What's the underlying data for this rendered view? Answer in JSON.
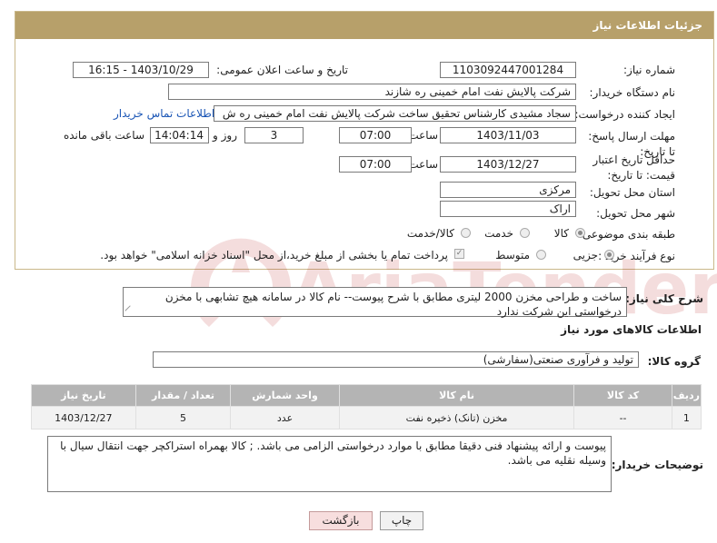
{
  "header": {
    "title": "جزئیات اطلاعات نیاز"
  },
  "labels": {
    "need_number": "شماره نیاز:",
    "announce_datetime": "تاریخ و ساعت اعلان عمومی:",
    "buyer_org": "نام دستگاه خریدار:",
    "requester": "ایجاد کننده درخواست:",
    "reply_deadline": "مهلت ارسال پاسخ: تا تاریخ:",
    "price_validity": "حداقل تاریخ اعتبار قیمت: تا تاریخ:",
    "hour": "ساعت",
    "day_and": "روز و",
    "remaining": "ساعت باقی مانده",
    "province": "استان محل تحویل:",
    "city": "شهر محل تحویل:",
    "category": "طبقه بندی موضوعی:",
    "purchase_type": "نوع فرآیند خرید :",
    "description": "شرح کلی نیاز:",
    "goods_info": "اطلاعات کالاهای مورد نیاز",
    "goods_group": "گروه کالا:",
    "buyer_notes": "توضیحات خریدار:"
  },
  "values": {
    "need_number": "1103092447001284",
    "announce_datetime": "1403/10/29 - 16:15",
    "buyer_org": "شرکت پالایش نفت امام خمینی  ره  شازند",
    "requester": "سجاد مشیدی  کارشناس تحقیق ساخت شرکت پالایش نفت امام خمینی  ره  ش",
    "contact_link": "اطلاعات تماس خریدار",
    "reply_date": "1403/11/03",
    "reply_time": "07:00",
    "reply_days": "3",
    "reply_remaining": "14:04:14",
    "validity_date": "1403/12/27",
    "validity_time": "07:00",
    "province": "مرکزی",
    "city": "اراک",
    "description": "ساخت و طراحی مخزن 2000 لیتری مطابق با شرح پیوست-- نام کالا در سامانه هیچ تشابهی با مخزن درخواستی این شرکت ندارد",
    "goods_group": "تولید و فرآوری صنعتی(سفارشی)",
    "buyer_notes": "پیوست و ارائه پیشنهاد فنی دقیقا مطابق با موارد درخواستی الزامی می باشد. ; کالا بهمراه استراکچر جهت انتقال سیال با وسیله نقلیه می باشد."
  },
  "category_options": {
    "goods": "کالا",
    "service": "خدمت",
    "goods_service": "کالا/خدمت",
    "selected": "کالا"
  },
  "purchase_options": {
    "partial": "جزیی",
    "medium": "متوسط",
    "treasury_note": "پرداخت تمام یا بخشی از مبلغ خرید،از محل \"اسناد خزانه اسلامی\" خواهد بود.",
    "selected": "جزیی"
  },
  "table": {
    "headers": [
      "ردیف",
      "کد کالا",
      "نام کالا",
      "واحد شمارش",
      "تعداد / مقدار",
      "تاریخ نیاز"
    ],
    "rows": [
      {
        "row": "1",
        "code": "--",
        "name": "مخزن (تانک) ذخیره نفت",
        "unit": "عدد",
        "qty": "5",
        "date": "1403/12/27"
      }
    ]
  },
  "buttons": {
    "print": "چاپ",
    "back": "بازگشت"
  },
  "watermark": {
    "text": "AriaTender.net"
  },
  "colors": {
    "header_bg": "#b7a06a",
    "table_header_bg": "#b4b4b4",
    "link": "#1a55b5",
    "back_button_bg": "#f7dede"
  }
}
